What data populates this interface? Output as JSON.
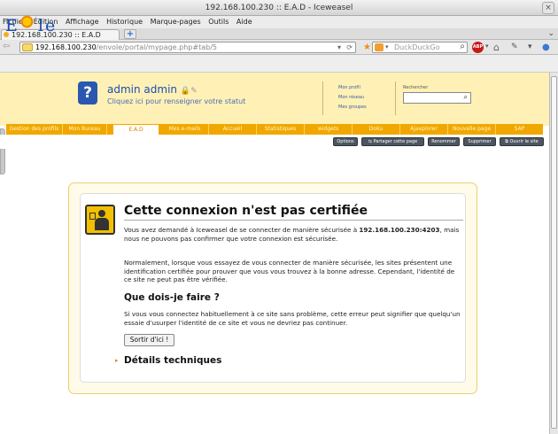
{
  "window": {
    "title": "192.168.100.230 :: E.A.D - Iceweasel",
    "close": "×"
  },
  "menu": [
    "Fichier",
    "Édition",
    "Affichage",
    "Historique",
    "Marque-pages",
    "Outils",
    "Aide"
  ],
  "tabs": [
    {
      "label": "192.168.100.230 :: E.A.D"
    }
  ],
  "tabbar": {
    "new_tab": "+",
    "list": "⌄"
  },
  "nav": {
    "url_domain": "192.168.100.230",
    "url_path": "/envole/portal/mypage.php#tab/5",
    "search_placeholder": "DuckDuckGo",
    "adblock": "ABP"
  },
  "portal": {
    "logo_left": "E",
    "logo_right": "le",
    "user_name": "admin admin",
    "user_status": "Cliquez ici pour renseigner votre statut",
    "links": [
      "Mon profil",
      "Mon réseau",
      "Mes groupes"
    ],
    "search_label": "Rechercher",
    "tabs": [
      "Gestion des profils",
      "Mon Bureau",
      "E.A.D",
      "Mes e-mails",
      "Accueil",
      "Statistiques",
      "widgets",
      "Doku",
      "Ajaxplorer",
      "Nouvelle page",
      "SAP"
    ],
    "actions": [
      "Options",
      "Partager cette page",
      "Renommer",
      "Supprimer",
      "Ouvrir le site"
    ]
  },
  "error": {
    "title": "Cette connexion n'est pas certifiée",
    "p1_pre": "Vous avez demandé à Iceweasel de se connecter de manière sécurisée à ",
    "p1_host": "192.168.100.230:4203",
    "p1_post": ", mais nous ne pouvons pas confirmer que votre connexion est sécurisée.",
    "p2": "Normalement, lorsque vous essayez de vous connecter de manière sécurisée, les sites présentent une identification certifiée pour prouver que vous vous trouvez à la bonne adresse. Cependant, l'identité de ce site ne peut pas être vérifiée.",
    "subheading": "Que dois-je faire ?",
    "p3": "Si vous vous connectez habituellement à ce site sans problème, cette erreur peut signifier que quelqu'un essaie d'usurper l'identité de ce site et vous ne devriez pas continuer.",
    "button": "Sortir d'ici !",
    "details": "Détails techniques"
  }
}
